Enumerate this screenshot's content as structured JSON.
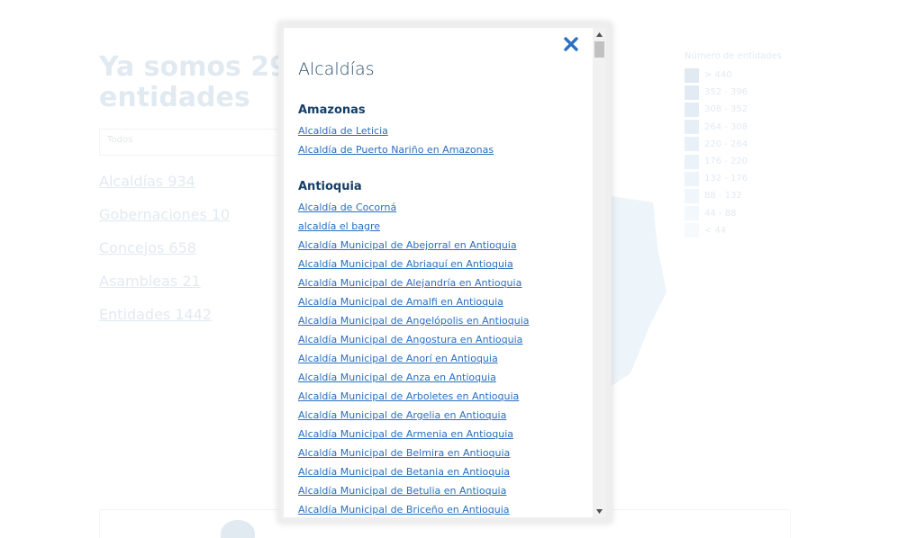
{
  "background": {
    "title_line1": "Ya somos 29",
    "title_line2": "entidades",
    "search_value": "Todos",
    "links": [
      "Alcaldías 934",
      "Gobernaciones 10",
      "Concejos 658",
      "Asambleas 21",
      "Entidades 1442"
    ],
    "legend": {
      "title": "Número de entidades",
      "rows": [
        {
          "label": "> 440",
          "color": "#1e5a9c"
        },
        {
          "label": "352 - 396",
          "color": "#2c68a8"
        },
        {
          "label": "308 - 352",
          "color": "#3a76b4"
        },
        {
          "label": "264 - 308",
          "color": "#4a84bf"
        },
        {
          "label": "220 - 264",
          "color": "#5b93c9"
        },
        {
          "label": "176 - 220",
          "color": "#6ca1d2"
        },
        {
          "label": "132 - 176",
          "color": "#7eb0db"
        },
        {
          "label": "88 - 132",
          "color": "#92bfe3"
        },
        {
          "label": "44 - 88",
          "color": "#a7cdea"
        },
        {
          "label": "< 44",
          "color": "#bddbf1"
        }
      ]
    }
  },
  "modal": {
    "title": "Alcaldías",
    "close_icon": "close-x-icon",
    "close_color": "#2a6fc0",
    "sections": [
      {
        "heading": "Amazonas",
        "items": [
          "Alcaldía de Leticia",
          "Alcaldía de Puerto Nariño en Amazonas"
        ]
      },
      {
        "heading": "Antioquia",
        "items": [
          "Alcaldía de Cocorná",
          "alcaldía el bagre",
          "Alcaldía Municipal de Abejorral en Antioquia",
          "Alcaldía Municipal de Abriaquí en Antioquia",
          "Alcaldía Municipal de Alejandría en Antioquia",
          "Alcaldía Municipal de Amalfi en Antioquia",
          "Alcaldía Municipal de Angelópolis en Antioquia",
          "Alcaldía Municipal de Angostura en Antioquia",
          "Alcaldía Municipal de Anorí en Antioquia",
          "Alcaldía Municipal de Anza en Antioquia",
          "Alcaldía Municipal de Arboletes en Antioquia",
          "Alcaldía Municipal de Argelia en Antioquia",
          "Alcaldía Municipal de Armenia en Antioquia",
          "Alcaldía Municipal de Belmira en Antioquia",
          "Alcaldía Municipal de Betania en Antioquia",
          "Alcaldía Municipal de Betulia en Antioquia",
          "Alcaldía Municipal de Briceño en Antioquia"
        ]
      }
    ]
  }
}
